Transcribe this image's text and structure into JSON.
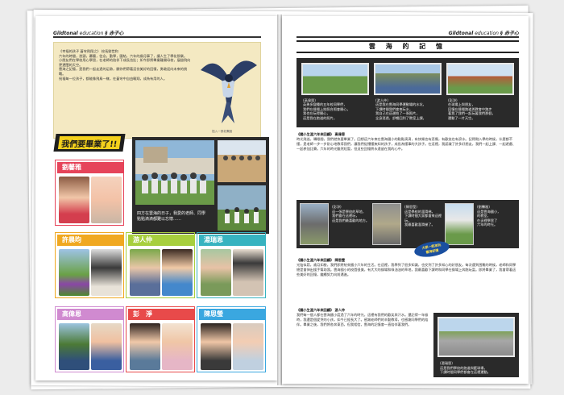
{
  "left_page": {
    "header_script": "Gildtonal",
    "header_text": "education",
    "header_tail": "§ 赤子心",
    "poem": "《幸福的孩子 蒼穹飛翔之》 校長劉世和\n六年的時間，悉頭，幕簡，信念，勤學，團結，六年的歲月事了，讓人生了學化那樂。\n小朋友們在學校用心學習，在老師的陪伴下成長茁壯；如今即將畢業離開母校，展翅飛向更遼闊的天空。\n雲海之記憶，是我們一起走過的足跡，願你們帶著這份美好的回憶，勇敢迎向未來的挑戰。\n祝福每一位孩子，都能像飛鳥一樣，在蒼穹中自由翱翔，成為有用的人。",
    "bird_credit": "插入一張老鷹圖",
    "graduates_banner": "我們要畢業了!!",
    "group_caption": "四方在雲海的日子，我愛的老師、同學\n點點滴滴都難以忘懷……",
    "cards": [
      {
        "name": "劉馨雅",
        "color": "#e6445a"
      },
      {
        "name": "許晨昀",
        "color": "#f0a820"
      },
      {
        "name": "游人仲",
        "color": "#a7cf3d"
      },
      {
        "name": "湯瑞恩",
        "color": "#37b3c0"
      },
      {
        "name": "高偉恩",
        "color": "#d08ad0"
      },
      {
        "name": "彭　淨",
        "color": "#e84a4a"
      },
      {
        "name": "陳思瑩",
        "color": "#3aa7e0"
      }
    ]
  },
  "right_page": {
    "header_script": "Gildtonal",
    "header_text": "education",
    "header_tail": "§ 赤子心",
    "title": "雲 海 的 記 憶",
    "top_captions": [
      "(高偉恩)\n英勇多變種的五年校同學們，\n我們在操場上拍照合照會開心，\n我也在玩得開心，\n這是我在跑道的照片。",
      "(游人仲)\n這是我在雲海同學運動場的水坑，\n下課時間我們會來玩水，\n我自己在這邊拍了一張照片，\n全身溼透，舒暢回到了教室上課。",
      "(彭淨)\n在球場上與朋友，\n回憶在操場跑道與教會中跑步\n著我了我們一起玩著我們那個，\n運動了一片天空。"
    ],
    "sections": [
      {
        "heading": "《國小生涯六年來回顧》 高偉恩",
        "body": "時光飛逝，轉眼間，我們就快要畢業了。回想這六年來在雲海國小的點點滴滴，有快樂也有悲傷，有歡笑也有淚水。記得剛入學的時候，什麼都不懂，是老師一步一步耐心地教導我們，讓我們從懵懂無知的孩子，成長為懂事的大孩子。在這裡，我認識了許多好朋友，我們一起上課、一起遊戲、一起參加比賽。六年的時光雖然短暫，但這些回憶將永遠留在我的心中。"
      },
      {
        "heading": "《國小生涯六年來回顧》 陳思瑩",
        "body": "光陰似箭，歲月如梭，我們即將結束國小六年的生活。在這裡，我學到了很多知識，也交到了許多知心的好朋友。每次遇到困難的時候，老師和同學總是會伸出援手幫助我。雲海國小的校園很美，有大大的操場和綠油油的草地，我最喜歡下課時和同學在操場上奔跑玩耍。即將畢業了，我會帶著這些美好的回憶，繼續努力向前邁進。"
      },
      {
        "heading": "《國小生涯六年來回顧》 游人仲",
        "body": "我們每一個人都在雲海國小度過了六年的時光，這裡有我們的歡笑與汗水。還記得一年級時，我還是個愛哭的小孩，如今已經長大了。感謝老師們的辛勤教導，也感謝同學們的陪伴。畢業之後，我們將各奔東西，但我相信，雲海的記憶會一直陪伴著我們。"
      }
    ],
    "mid_captions": [
      "(彭淨)\n這一張是學校的草地，\n我們會在這裡玩，\n這是我們最喜歡的地方。",
      "(陳思瑩)\n這是學校的溜滑梯，\n下課時間大家都會來這裡玩，\n我最喜歡溜滑梯了。",
      "(劉馨雅)\n這是雲海國小，\n的教室，\n在這裡學習了\n六年的時光。"
    ],
    "burst_text": "大家一起來玩\n雲海記憶",
    "bottom_caption": "(湯瑞恩)\n這是我們學校的跑道與籃球場，\n下課時間同學們都會在這裡運動。"
  }
}
